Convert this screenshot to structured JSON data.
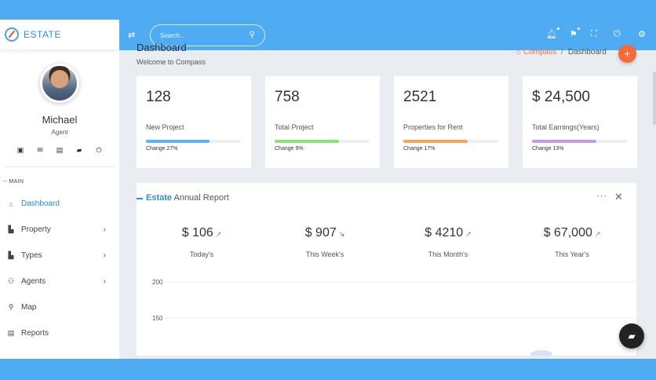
{
  "brand": {
    "name": "ESTATE"
  },
  "profile": {
    "name": "Michael",
    "role": "Agent"
  },
  "user_actions": [
    {
      "icon": "calendar-icon",
      "glyph": "▣"
    },
    {
      "icon": "mail-icon",
      "glyph": "✉"
    },
    {
      "icon": "contact-card-icon",
      "glyph": "▤"
    },
    {
      "icon": "chat-icon",
      "glyph": "▰"
    },
    {
      "icon": "power-icon",
      "glyph": "⏻"
    }
  ],
  "sidebar": {
    "section": "-- MAIN",
    "items": [
      {
        "label": "Dashboard",
        "icon": "home-icon",
        "glyph": "⌂",
        "active": true,
        "chevron": false
      },
      {
        "label": "Property",
        "icon": "building-icon",
        "glyph": "▙",
        "active": false,
        "chevron": true
      },
      {
        "label": "Types",
        "icon": "building-icon",
        "glyph": "▙",
        "active": false,
        "chevron": true
      },
      {
        "label": "Agents",
        "icon": "users-icon",
        "glyph": "⚇",
        "active": false,
        "chevron": true
      },
      {
        "label": "Map",
        "icon": "map-pin-icon",
        "glyph": "⚲",
        "active": false,
        "chevron": false
      },
      {
        "label": "Reports",
        "icon": "document-icon",
        "glyph": "▤",
        "active": false,
        "chevron": false
      }
    ]
  },
  "header": {
    "search_placeholder": "Search..."
  },
  "page": {
    "title": "Dashboard",
    "subtitle": "Welcome to Compass"
  },
  "breadcrumb": {
    "home": "Compass",
    "separator": "/",
    "current": "Dashboard"
  },
  "stats": [
    {
      "value": "128",
      "label": "New Project",
      "change": "Change 27%",
      "progress": 0.67,
      "color": "#5bb3f5"
    },
    {
      "value": "758",
      "label": "Total Project",
      "change": "Change 9%",
      "progress": 0.68,
      "color": "#8ee07a"
    },
    {
      "value": "2521",
      "label": "Properties for Rent",
      "change": "Change 17%",
      "progress": 0.68,
      "color": "#f5a65b"
    },
    {
      "value": "$ 24,500",
      "label": "Total Earnings(Years)",
      "change": "Change 13%",
      "progress": 0.68,
      "color": "#c89ae0"
    }
  ],
  "report": {
    "title_accent": "Estate",
    "title_rest": "Annual Report",
    "kpis": [
      {
        "value": "$ 106",
        "label": "Today's",
        "trend": "up",
        "trend_color": "#4caf50"
      },
      {
        "value": "$ 907",
        "label": "This Week's",
        "trend": "down",
        "trend_color": "#e53935"
      },
      {
        "value": "$ 4210",
        "label": "This Month's",
        "trend": "up",
        "trend_color": "#4caf50"
      },
      {
        "value": "$ 67,000",
        "label": "This Year's",
        "trend": "up",
        "trend_color": "#4caf50"
      }
    ],
    "chart_ticks": [
      "200",
      "150"
    ]
  },
  "colors": {
    "accent": "#4facf3",
    "brand": "#2f8fdc",
    "fab": "#f56a36",
    "breadcrumb_home": "#f36c3f"
  }
}
